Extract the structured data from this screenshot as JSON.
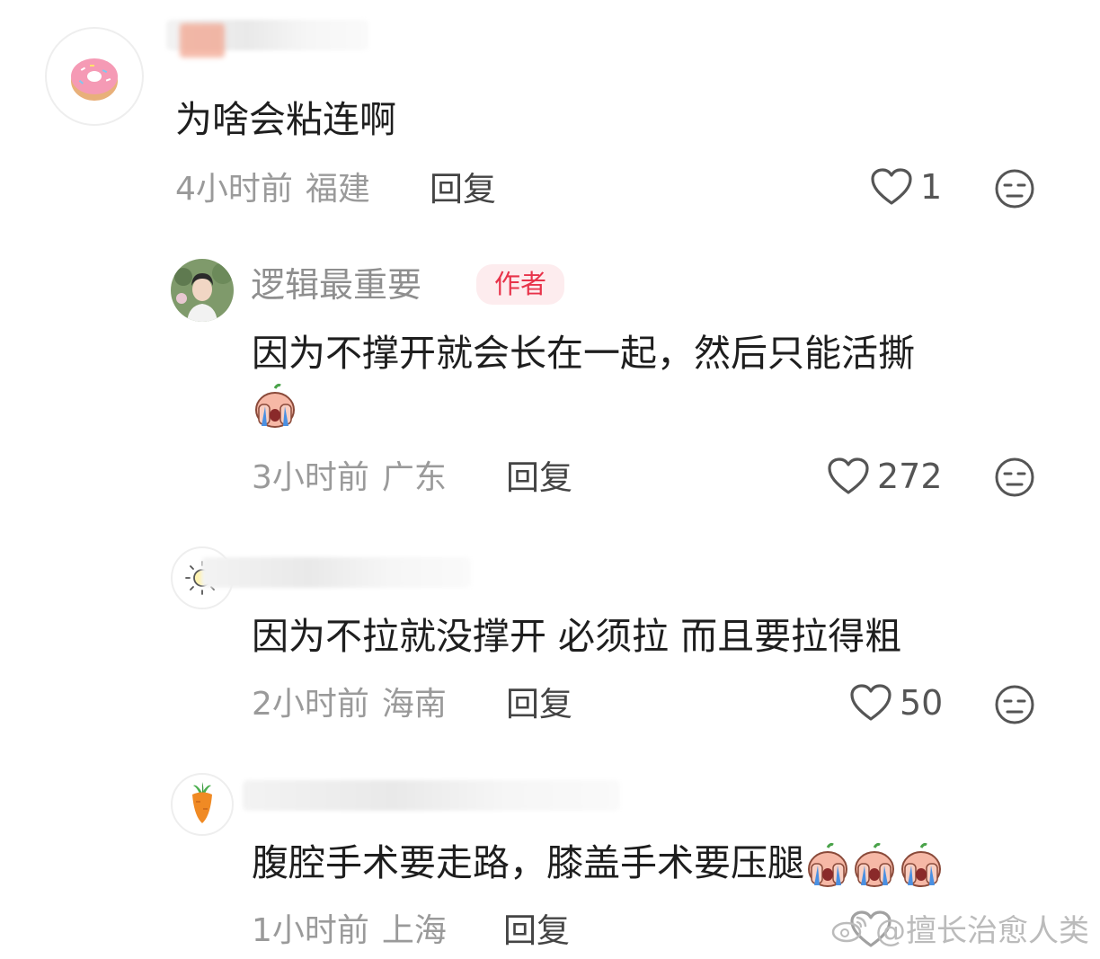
{
  "comments": [
    {
      "username": "",
      "text": "为啥会粘连啊",
      "time": "4小时前",
      "location": "福建",
      "reply_label": "回复",
      "likes": "1",
      "avatar_icon": "donut-icon"
    },
    {
      "username": "逻辑最重要",
      "author_tag": "作者",
      "text": "因为不撑开就会长在一起，然后只能活撕",
      "time": "3小时前",
      "location": "广东",
      "reply_label": "回复",
      "likes": "272",
      "avatar_icon": "person-photo-avatar"
    },
    {
      "username": "",
      "text": "因为不拉就没撑开 必须拉 而且要拉得粗",
      "time": "2小时前",
      "location": "海南",
      "reply_label": "回复",
      "likes": "50",
      "avatar_icon": "sun-icon"
    },
    {
      "username": "",
      "text": "腹腔手术要走路，膝盖手术要压腿",
      "time": "1小时前",
      "location": "上海",
      "reply_label": "回复",
      "likes": "",
      "avatar_icon": "carrot-icon"
    }
  ],
  "watermark": "@擅长治愈人类",
  "colors": {
    "author_tag_bg": "#fdecee",
    "author_tag_text": "#e8334a",
    "meta_text": "#9a9a9a"
  }
}
